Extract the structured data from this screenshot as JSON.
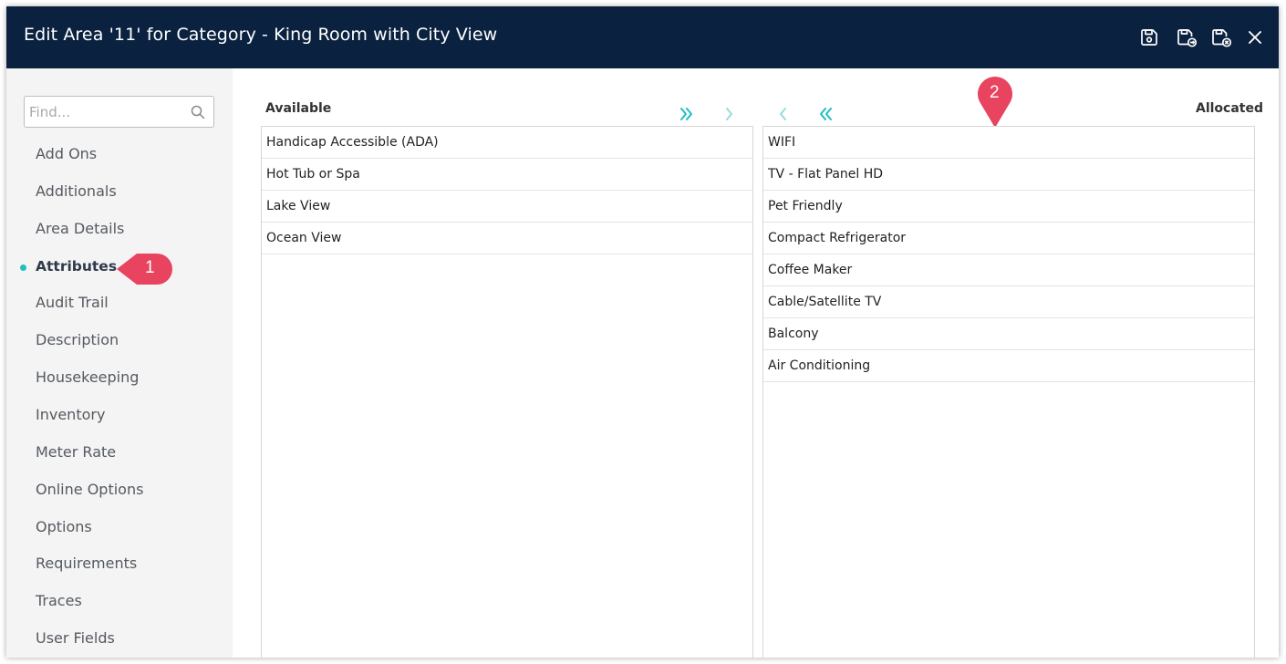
{
  "window": {
    "title": "Edit Area '11' for Category - King Room with City View",
    "toolbar_icons": [
      "save-icon",
      "save-new-icon",
      "save-close-icon",
      "close-icon"
    ]
  },
  "sidebar": {
    "search_placeholder": "Find...",
    "items": [
      {
        "label": "Add Ons"
      },
      {
        "label": "Additionals"
      },
      {
        "label": "Area Details"
      },
      {
        "label": "Attributes",
        "active": true
      },
      {
        "label": "Audit Trail"
      },
      {
        "label": "Description"
      },
      {
        "label": "Housekeeping"
      },
      {
        "label": "Inventory"
      },
      {
        "label": "Meter Rate"
      },
      {
        "label": "Online Options"
      },
      {
        "label": "Options"
      },
      {
        "label": "Requirements"
      },
      {
        "label": "Traces"
      },
      {
        "label": "User Fields"
      }
    ]
  },
  "callouts": {
    "one": "1",
    "two": "2"
  },
  "available": {
    "label": "Available",
    "items": [
      "Handicap Accessible (ADA)",
      "Hot Tub or Spa",
      "Lake View",
      "Ocean View"
    ]
  },
  "allocated": {
    "label": "Allocated",
    "items": [
      "WIFI",
      "TV - Flat Panel HD",
      "Pet Friendly",
      "Compact Refrigerator",
      "Coffee Maker",
      "Cable/Satellite TV",
      "Balcony",
      "Air Conditioning"
    ]
  },
  "colors": {
    "title_bar": "#0a2240",
    "accent_teal": "#21bfc0",
    "callout": "#e8435f"
  }
}
